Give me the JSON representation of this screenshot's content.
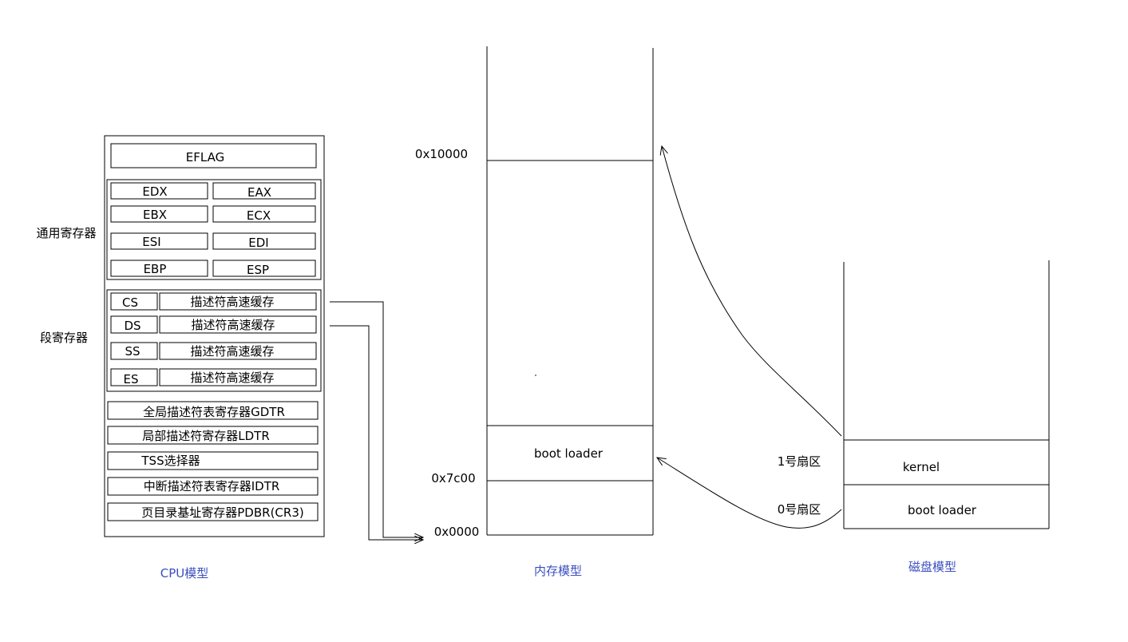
{
  "cpu": {
    "eflag": "EFLAG",
    "general_label": "通用寄存器",
    "general_registers": [
      "EDX",
      "EAX",
      "EBX",
      "ECX",
      "ESI",
      "EDI",
      "EBP",
      "ESP"
    ],
    "segment_label": "段寄存器",
    "segment_registers": [
      {
        "name": "CS",
        "cache": "描述符高速缓存"
      },
      {
        "name": "DS",
        "cache": "描述符高速缓存"
      },
      {
        "name": "SS",
        "cache": "描述符高速缓存"
      },
      {
        "name": "ES",
        "cache": "描述符高速缓存"
      }
    ],
    "system_registers": [
      "全局描述符表寄存器GDTR",
      "局部描述符寄存器LDTR",
      "TSS选择器",
      "中断描述符表寄存器IDTR",
      "页目录基址寄存器PDBR(CR3)"
    ],
    "caption": "CPU模型"
  },
  "memory": {
    "addresses": [
      "0x10000",
      "0x7c00",
      "0x0000"
    ],
    "boot_loader": "boot loader",
    "caption": "内存模型"
  },
  "disk": {
    "sector1_label": "1号扇区",
    "sector0_label": "0号扇区",
    "kernel": "kernel",
    "boot_loader": "boot loader",
    "caption": "磁盘模型"
  }
}
